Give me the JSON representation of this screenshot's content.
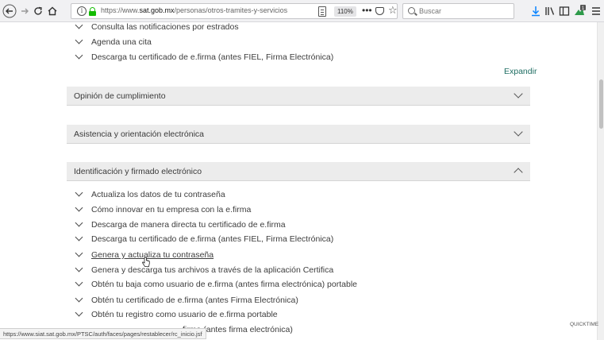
{
  "browser": {
    "url_prefix": "https://www.",
    "url_host": "sat.gob.mx",
    "url_path": "/personas/otros-tramites-y-servicios",
    "zoom": "110%",
    "search_placeholder": "Buscar",
    "badge_count": "1"
  },
  "top_links": [
    "Consulta las notificaciones por estrados",
    "Agenda una cita",
    "Descarga tu certificado de e.firma (antes FIEL, Firma Electrónica)"
  ],
  "expand_label": "Expandir",
  "sections": [
    {
      "title": "Opinión de cumplimiento",
      "state": "collapsed"
    },
    {
      "title": "Asistencia y orientación electrónica",
      "state": "collapsed"
    },
    {
      "title": "Identificación y firmado electrónico",
      "state": "expanded"
    }
  ],
  "section_links": [
    "Actualiza los datos de tu contraseña",
    "Cómo innovar en tu empresa con la e.firma",
    "Descarga de manera directa tu certificado de e.firma",
    "Descarga tu certificado de e.firma (antes FIEL, Firma Electrónica)",
    "Genera y actualiza tu contraseña",
    "Genera y descarga tus archivos a través de la aplicación Certifica",
    "Obtén tu baja como usuario de e.firma (antes firma electrónica) portable",
    "Obtén tu certificado de e.firma (antes Firma Electrónica)",
    "Obtén tu registro como usuario de e.firma portable",
    "firma (antes firma electrónica)"
  ],
  "status_url": "https://www.siat.sat.gob.mx/PTSC/auth/faces/pages/restablecer/rc_inicio.jsf",
  "watermark": "QUICKTIME"
}
